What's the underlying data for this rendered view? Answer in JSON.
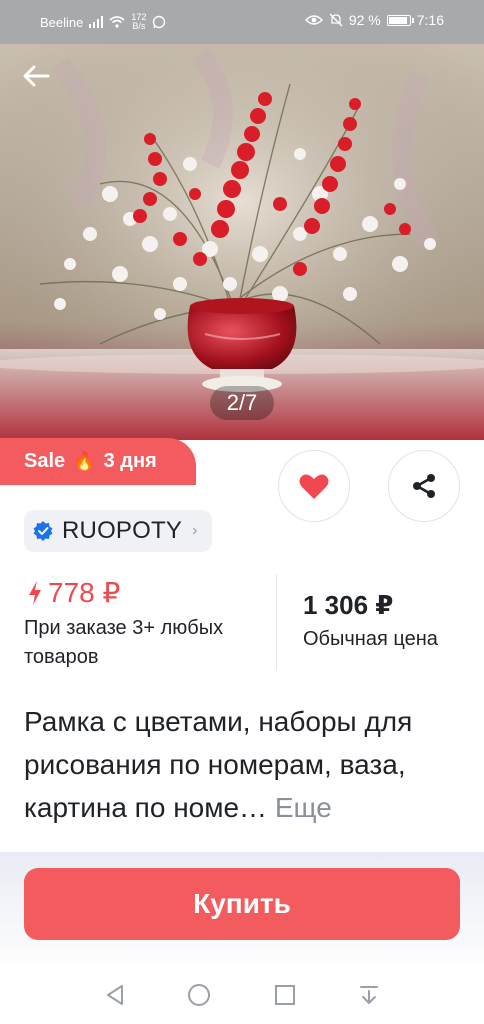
{
  "status_bar": {
    "carrier": "Beeline",
    "speed_value": "172",
    "speed_unit": "B/s",
    "battery": "92 %",
    "time": "7:16"
  },
  "gallery": {
    "page_indicator": "2/7"
  },
  "badges": {
    "sale_label": "Sale",
    "sale_days": "3 дня"
  },
  "store": {
    "name": "RUOPOTY"
  },
  "pricing": {
    "promo_price": "778 ₽",
    "promo_note": "При заказе 3+ любых товаров",
    "regular_price": "1 306 ₽",
    "regular_label": "Обычная цена"
  },
  "product": {
    "title": "Рамка с цветами, наборы для рисования по номерам, ваза, картина по номе…",
    "more_label": "Еще"
  },
  "actions": {
    "buy_label": "Купить"
  },
  "colors": {
    "accent": "#f45b5f",
    "promo_text": "#f0484e",
    "verified": "#1a73e8"
  },
  "icons": [
    "back-arrow-icon",
    "heart-icon",
    "share-icon",
    "verified-icon",
    "lightning-icon",
    "fire-icon"
  ]
}
